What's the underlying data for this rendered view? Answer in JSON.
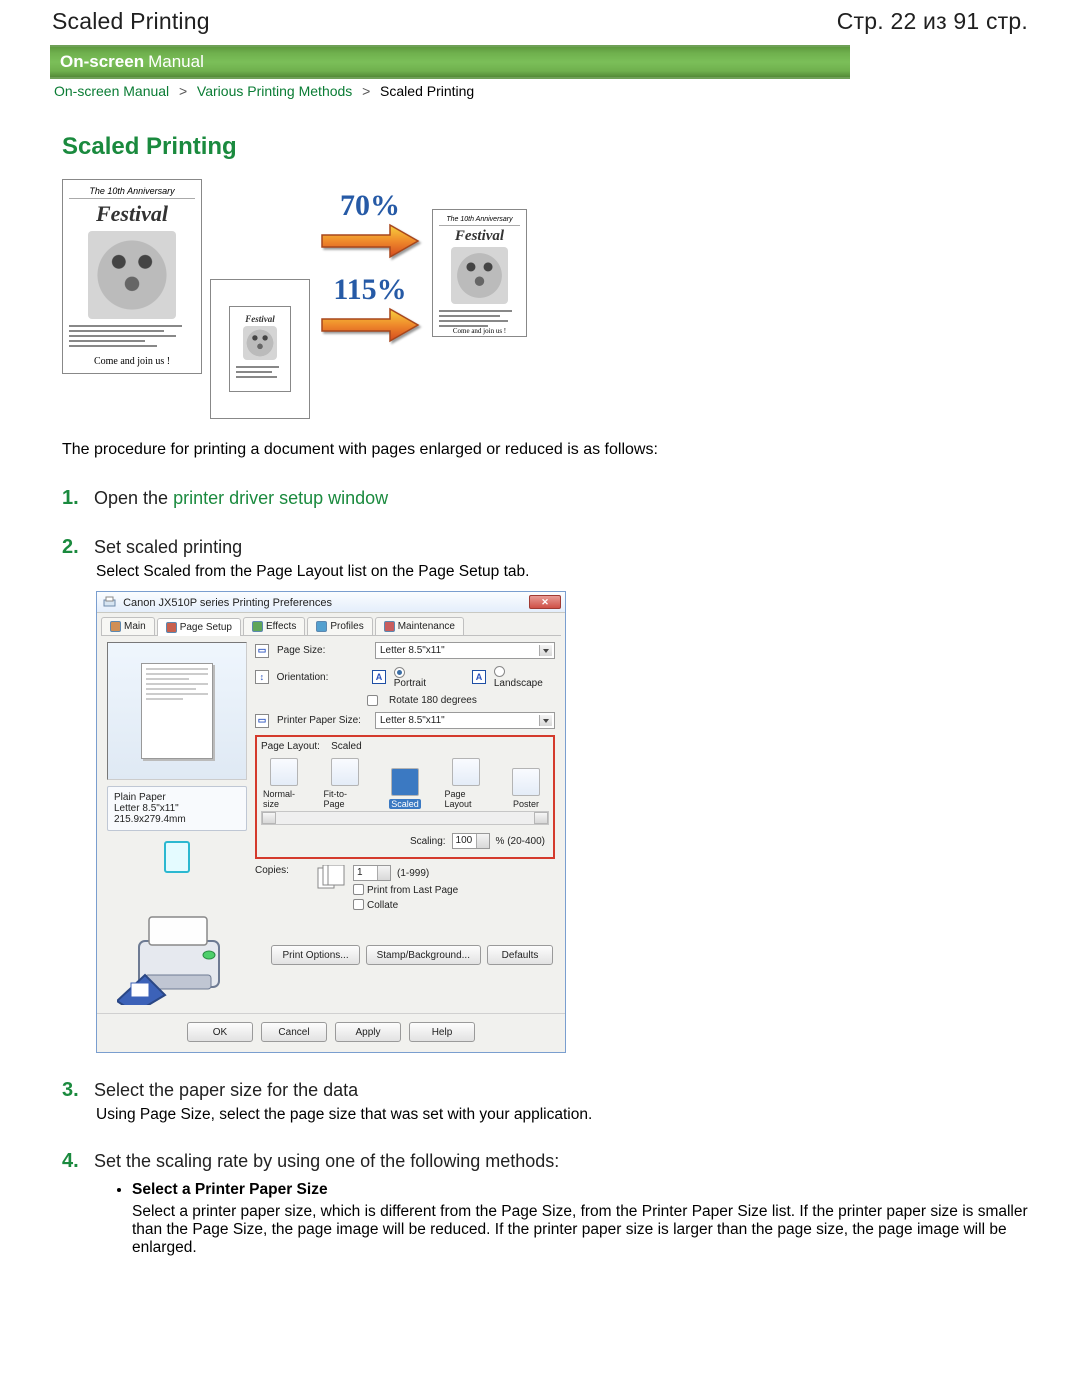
{
  "header": {
    "left": "Scaled Printing",
    "right": "Стр. 22 из 91 стр."
  },
  "banner": {
    "bold": "On-screen",
    "rest": "Manual"
  },
  "breadcrumb": {
    "a": "On-screen Manual",
    "b": "Various Printing Methods",
    "c": "Scaled Printing"
  },
  "page_title": "Scaled Printing",
  "hero": {
    "card_top": "The 10th Anniversary",
    "card_brand": "Festival",
    "card_foot": "Come and join us !",
    "pct_up": "70%",
    "pct_down": "115%"
  },
  "intro": "The procedure for printing a document with pages enlarged or reduced is as follows:",
  "steps": {
    "s1": {
      "num": "1.",
      "pre": "Open the ",
      "link": "printer driver setup window"
    },
    "s2": {
      "num": "2.",
      "title": "Set scaled printing",
      "body": "Select Scaled from the Page Layout list on the Page Setup tab."
    },
    "s3": {
      "num": "3.",
      "title": "Select the paper size for the data",
      "body": "Using Page Size, select the page size that was set with your application."
    },
    "s4": {
      "num": "4.",
      "title": "Set the scaling rate by using one of the following methods:",
      "sub_title": "Select a Printer Paper Size",
      "sub_body": "Select a printer paper size, which is different from the Page Size, from the Printer Paper Size list. If the printer paper size is smaller than the Page Size, the page image will be reduced. If the printer paper size is larger than the page size, the page image will be enlarged."
    }
  },
  "dialog": {
    "title": "Canon JX510P series Printing Preferences",
    "tabs": [
      "Main",
      "Page Setup",
      "Effects",
      "Profiles",
      "Maintenance"
    ],
    "info1": "Plain Paper",
    "info2": "Letter 8.5\"x11\" 215.9x279.4mm",
    "page_size_label": "Page Size:",
    "page_size_value": "Letter 8.5\"x11\"",
    "orientation_label": "Orientation:",
    "portrait": "Portrait",
    "landscape": "Landscape",
    "rotate": "Rotate 180 degrees",
    "printer_paper_label": "Printer Paper Size:",
    "printer_paper_value": "Letter 8.5\"x11\"",
    "page_layout_label": "Page Layout:",
    "page_layout_value": "Scaled",
    "layouts": [
      "Normal-size",
      "Fit-to-Page",
      "Scaled",
      "Page Layout",
      "Poster"
    ],
    "scaling_label": "Scaling:",
    "scaling_value": "100",
    "scaling_range": "% (20-400)",
    "copies_label": "Copies:",
    "copies_value": "1",
    "copies_range": "(1-999)",
    "print_from_last": "Print from Last Page",
    "collate": "Collate",
    "btn_print_options": "Print Options...",
    "btn_stamp": "Stamp/Background...",
    "btn_defaults": "Defaults",
    "btn_ok": "OK",
    "btn_cancel": "Cancel",
    "btn_apply": "Apply",
    "btn_help": "Help"
  }
}
